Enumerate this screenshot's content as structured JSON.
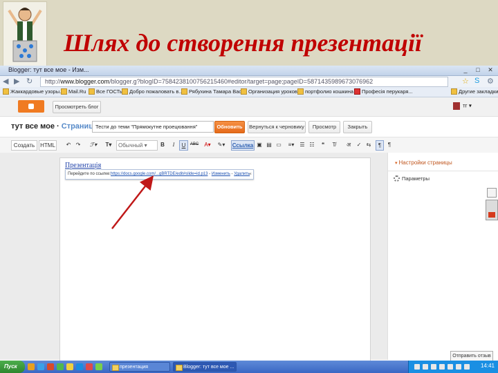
{
  "slide": {
    "title": "Шлях до створення презентації",
    "title_color": "#c00000",
    "banner_color": "#ddd9c3"
  },
  "browser": {
    "tab_title": "Blogger: тут все мое - Изм...",
    "url_prefix": "http://",
    "url_host": "www.blogger.com",
    "url_path": "/blogger.g?blogID=7584238100756215460#editor/target=page;pageID=5871435989673076962",
    "bookmarks": [
      "Жаккардовые узоры...",
      "Mail.Ru",
      "Все ГОСТы",
      "Добро пожаловать в...",
      "Рябухина Тамара Вас...",
      "Организация уроков ...",
      "портфолио кошкина ...",
      "Професія перукаря...",
      "Другие закладки"
    ]
  },
  "blogger": {
    "view_blog": "Просмотреть блог",
    "user": "тг",
    "blog_name": "тут все мое",
    "page_word": "Страница",
    "post_title": "Тести до теми \"Прямокутне проецювання\"",
    "update_btn": "Обновить",
    "revert_btn": "Вернуться к черновику",
    "preview_btn": "Просмотр",
    "close_btn": "Закрыть"
  },
  "toolbar": {
    "compose": "Создать",
    "html": "HTML",
    "font_size": "Обычный",
    "link": "Ссылка"
  },
  "editor": {
    "link_text": "Презентація",
    "bubble_label": "Перейдите по ссылке:",
    "bubble_url": "https://docs.google.com/...gBRTDE/edit#slide=id.p13",
    "bubble_change": "Изменить",
    "bubble_remove": "Удалить",
    "bubble_close": "×"
  },
  "sidebar": {
    "settings_head": "Настройки страницы",
    "params": "Параметры"
  },
  "feedback": "Отправить отзыв",
  "taskbar": {
    "start": "Пуск",
    "tasks": [
      "презентация",
      "Blogger: тут все мое ..."
    ],
    "clock": "14:41"
  }
}
